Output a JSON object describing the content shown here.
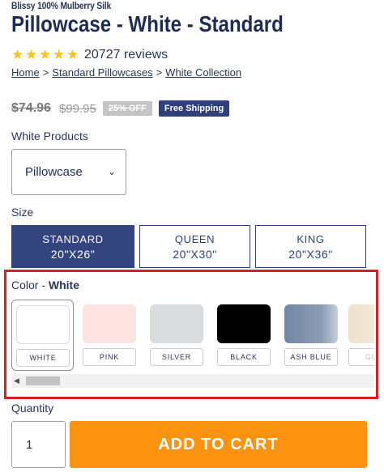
{
  "product": {
    "brand": "Blissy 100% Mulberry Silk",
    "title": "Pillowcase - White - Standard",
    "rating_stars": 5,
    "reviews": "20727 reviews"
  },
  "breadcrumb": {
    "items": [
      "Home",
      "Standard Pillowcases",
      "White Collection"
    ],
    "separator": ">"
  },
  "pricing": {
    "sale_price": "$74.96",
    "original_price": "$99.95",
    "discount_badge": "25% OFF",
    "shipping_badge": "Free Shipping"
  },
  "products_select": {
    "label": "White Products",
    "value": "Pillowcase"
  },
  "size": {
    "label": "Size",
    "options": [
      {
        "name": "STANDARD",
        "dims": "20\"X26\"",
        "selected": true
      },
      {
        "name": "QUEEN",
        "dims": "20\"X30\"",
        "selected": false
      },
      {
        "name": "KING",
        "dims": "20\"X36\"",
        "selected": false
      }
    ]
  },
  "color": {
    "label": "Color - ",
    "selected": "White",
    "swatches": [
      {
        "name": "WHITE",
        "hex": "#ffffff"
      },
      {
        "name": "PINK",
        "hex": "#fde3e1"
      },
      {
        "name": "SILVER",
        "hex": "#d9dde0"
      },
      {
        "name": "BLACK",
        "hex": "#000000"
      },
      {
        "name": "ASH BLUE",
        "hex": "#8193ad"
      },
      {
        "name": "GO",
        "hex": "#f2e4d0"
      }
    ]
  },
  "quantity": {
    "label": "Quantity",
    "value": "1"
  },
  "cart": {
    "button_label": "ADD TO CART"
  },
  "colors": {
    "navy": "#2e3f7a",
    "cart_orange": "#fb9210",
    "highlight_red": "#d32027",
    "star_yellow": "#f5c518"
  }
}
